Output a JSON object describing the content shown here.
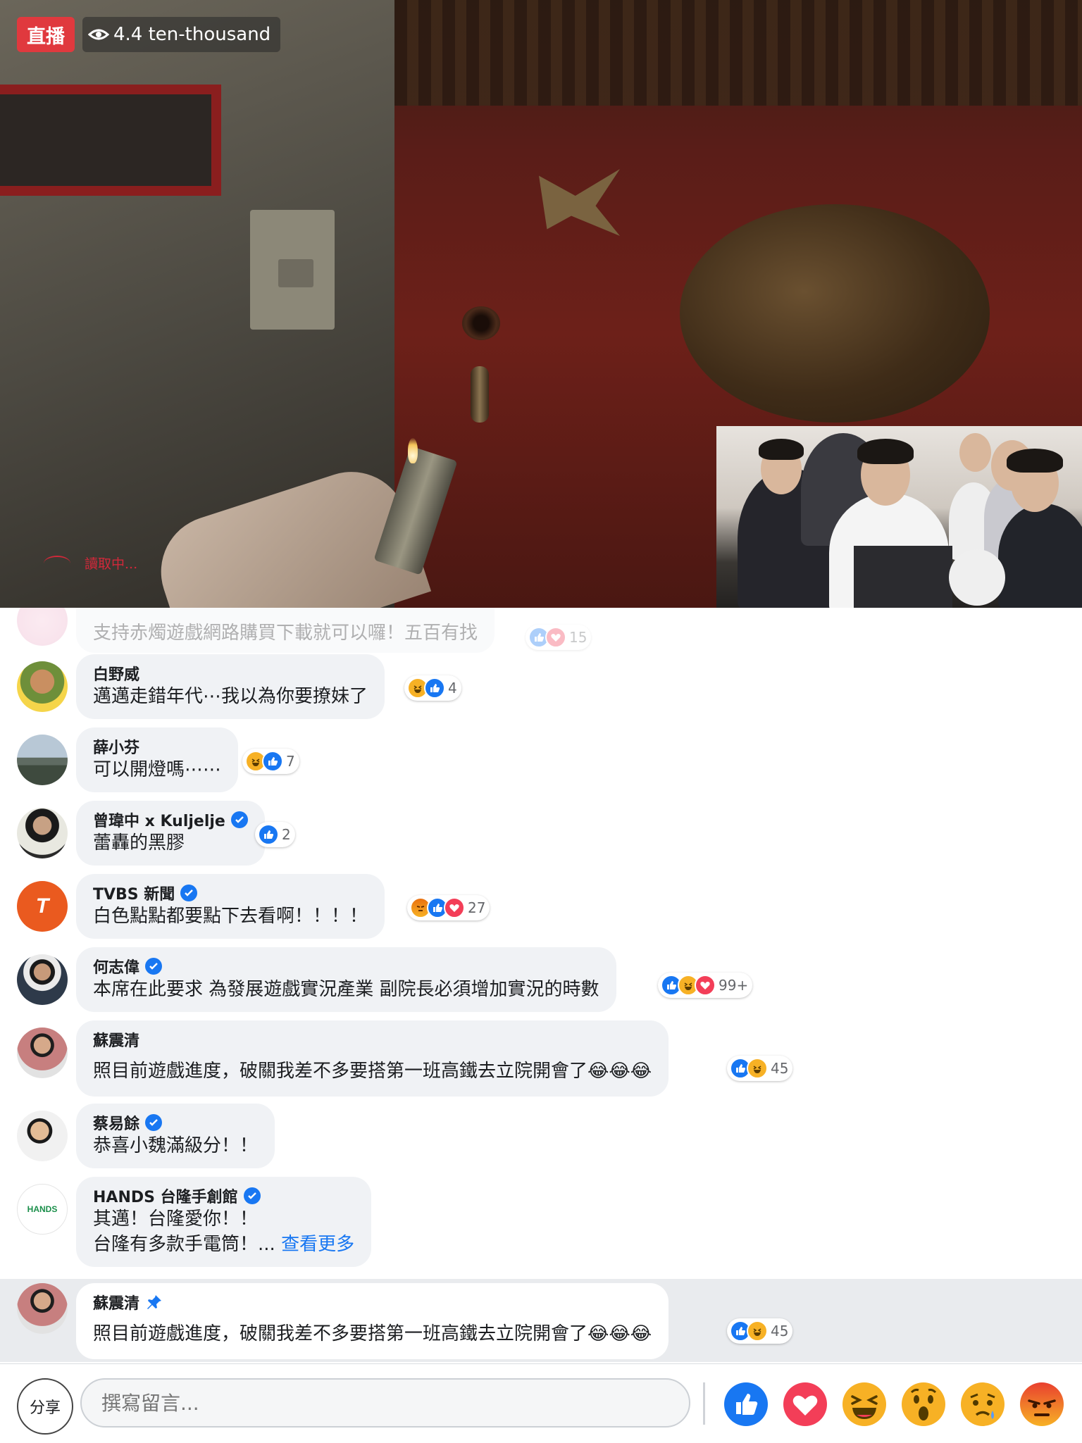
{
  "video": {
    "live_label": "直播",
    "viewer_count": "4.4 ten-thousand",
    "loading_text": "讀取中..."
  },
  "comments": [
    {
      "name": "",
      "text": "支持赤燭遊戲網路購買下載就可以囉！五百有找",
      "reactions": [
        "like",
        "love"
      ],
      "count": "15",
      "faded": true
    },
    {
      "name": "白野威",
      "text": "邁邁走錯年代⋯我以為你要撩妹了",
      "reactions": [
        "haha",
        "like"
      ],
      "count": "4"
    },
    {
      "name": "薛小芬",
      "text": "可以開燈嗎⋯⋯",
      "reactions": [
        "haha",
        "like"
      ],
      "count": "7"
    },
    {
      "name": "曾瑋中 x Kuljelje",
      "verified": true,
      "text": "蕾轟的黑膠",
      "reactions": [
        "like"
      ],
      "count": "2"
    },
    {
      "name": "TVBS 新聞",
      "verified": true,
      "text": "白色點點都要點下去看啊！！！！",
      "reactions": [
        "angry",
        "like",
        "love"
      ],
      "count": "27"
    },
    {
      "name": "何志偉",
      "verified": true,
      "text": "本席在此要求 為發展遊戲實況產業 副院長必須增加實況的時數",
      "reactions": [
        "like",
        "haha",
        "love"
      ],
      "count": "99+"
    },
    {
      "name": "蘇震清",
      "text": "照目前遊戲進度，破關我差不多要搭第一班高鐵去立院開會了😂😂😂",
      "reactions": [
        "like",
        "haha"
      ],
      "count": "45"
    },
    {
      "name": "蔡易餘",
      "verified": true,
      "text": "恭喜小魏滿級分！！",
      "reactions": [],
      "count": ""
    },
    {
      "name": "HANDS 台隆手創館",
      "verified": true,
      "text": "其邁！台隆愛你！！",
      "text2": "台隆有多款手電筒！...",
      "see_more": "查看更多",
      "reactions": [],
      "count": ""
    }
  ],
  "pinned_comment": {
    "name": "蘇震清",
    "text": "照目前遊戲進度，破關我差不多要搭第一班高鐵去立院開會了😂😂😂",
    "reactions": [
      "like",
      "haha"
    ],
    "count": "45"
  },
  "composer": {
    "share_label": "分享",
    "placeholder": "撰寫留言..."
  },
  "reaction_bar": [
    "like",
    "love",
    "haha",
    "wow",
    "sad",
    "angry"
  ],
  "colors": {
    "live_red": "#e0393e",
    "like_blue": "#1877f2",
    "love_red": "#f33e58",
    "emoji_yellow": "#f7b125",
    "bubble_gray": "#f0f2f5"
  }
}
